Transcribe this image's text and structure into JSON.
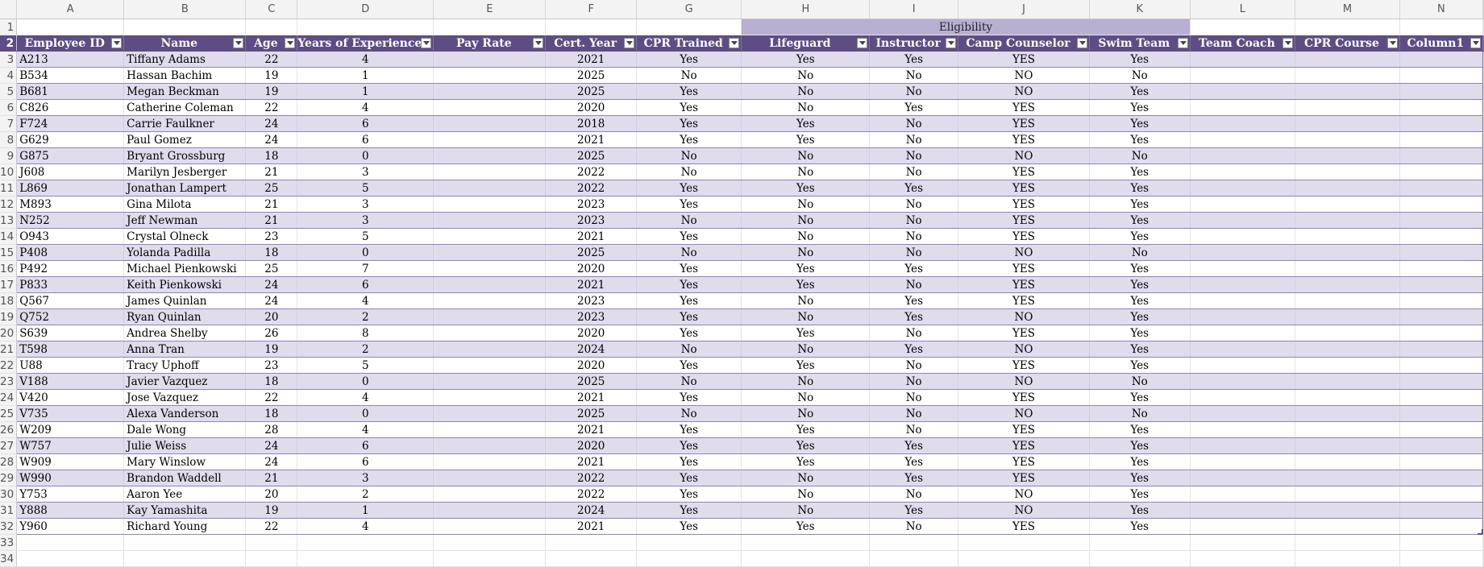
{
  "columns": [
    "A",
    "B",
    "C",
    "D",
    "E",
    "F",
    "G",
    "H",
    "I",
    "J",
    "K",
    "L",
    "M",
    "N"
  ],
  "eligibility_label": "Eligibility",
  "headers": [
    "Employee ID",
    "Name",
    "Age",
    "Years of Experience",
    "Pay Rate",
    "Cert. Year",
    "CPR Trained",
    "Lifeguard",
    "Instructor",
    "Camp Counselor",
    "Swim Team",
    "Team Coach",
    "CPR Course",
    "Column1"
  ],
  "rows": [
    [
      "A213",
      "Tiffany Adams",
      "22",
      "4",
      "",
      "2021",
      "Yes",
      "Yes",
      "Yes",
      "YES",
      "Yes"
    ],
    [
      "B534",
      "Hassan Bachim",
      "19",
      "1",
      "",
      "2025",
      "No",
      "No",
      "No",
      "NO",
      "No"
    ],
    [
      "B681",
      "Megan Beckman",
      "19",
      "1",
      "",
      "2025",
      "Yes",
      "No",
      "No",
      "NO",
      "Yes"
    ],
    [
      "C826",
      "Catherine Coleman",
      "22",
      "4",
      "",
      "2020",
      "Yes",
      "No",
      "Yes",
      "YES",
      "Yes"
    ],
    [
      "F724",
      "Carrie Faulkner",
      "24",
      "6",
      "",
      "2018",
      "Yes",
      "Yes",
      "No",
      "YES",
      "Yes"
    ],
    [
      "G629",
      "Paul Gomez",
      "24",
      "6",
      "",
      "2021",
      "Yes",
      "Yes",
      "No",
      "YES",
      "Yes"
    ],
    [
      "G875",
      "Bryant Grossburg",
      "18",
      "0",
      "",
      "2025",
      "No",
      "No",
      "No",
      "NO",
      "No"
    ],
    [
      "J608",
      "Marilyn Jesberger",
      "21",
      "3",
      "",
      "2022",
      "No",
      "No",
      "No",
      "YES",
      "Yes"
    ],
    [
      "L869",
      "Jonathan Lampert",
      "25",
      "5",
      "",
      "2022",
      "Yes",
      "Yes",
      "Yes",
      "YES",
      "Yes"
    ],
    [
      "M893",
      "Gina Milota",
      "21",
      "3",
      "",
      "2023",
      "Yes",
      "No",
      "No",
      "YES",
      "Yes"
    ],
    [
      "N252",
      "Jeff Newman",
      "21",
      "3",
      "",
      "2023",
      "No",
      "No",
      "No",
      "YES",
      "Yes"
    ],
    [
      "O943",
      "Crystal Olneck",
      "23",
      "5",
      "",
      "2021",
      "Yes",
      "No",
      "No",
      "YES",
      "Yes"
    ],
    [
      "P408",
      "Yolanda Padilla",
      "18",
      "0",
      "",
      "2025",
      "No",
      "No",
      "No",
      "NO",
      "No"
    ],
    [
      "P492",
      "Michael Pienkowski",
      "25",
      "7",
      "",
      "2020",
      "Yes",
      "Yes",
      "Yes",
      "YES",
      "Yes"
    ],
    [
      "P833",
      "Keith Pienkowski",
      "24",
      "6",
      "",
      "2021",
      "Yes",
      "Yes",
      "No",
      "YES",
      "Yes"
    ],
    [
      "Q567",
      "James Quinlan",
      "24",
      "4",
      "",
      "2023",
      "Yes",
      "No",
      "Yes",
      "YES",
      "Yes"
    ],
    [
      "Q752",
      "Ryan Quinlan",
      "20",
      "2",
      "",
      "2023",
      "Yes",
      "No",
      "Yes",
      "NO",
      "Yes"
    ],
    [
      "S639",
      "Andrea Shelby",
      "26",
      "8",
      "",
      "2020",
      "Yes",
      "Yes",
      "No",
      "YES",
      "Yes"
    ],
    [
      "T598",
      "Anna Tran",
      "19",
      "2",
      "",
      "2024",
      "No",
      "No",
      "Yes",
      "NO",
      "Yes"
    ],
    [
      "U88",
      "Tracy Uphoff",
      "23",
      "5",
      "",
      "2020",
      "Yes",
      "Yes",
      "No",
      "YES",
      "Yes"
    ],
    [
      "V188",
      "Javier Vazquez",
      "18",
      "0",
      "",
      "2025",
      "No",
      "No",
      "No",
      "NO",
      "No"
    ],
    [
      "V420",
      "Jose Vazquez",
      "22",
      "4",
      "",
      "2021",
      "Yes",
      "No",
      "No",
      "YES",
      "Yes"
    ],
    [
      "V735",
      "Alexa Vanderson",
      "18",
      "0",
      "",
      "2025",
      "No",
      "No",
      "No",
      "NO",
      "No"
    ],
    [
      "W209",
      "Dale Wong",
      "28",
      "4",
      "",
      "2021",
      "Yes",
      "Yes",
      "No",
      "YES",
      "Yes"
    ],
    [
      "W757",
      "Julie Weiss",
      "24",
      "6",
      "",
      "2020",
      "Yes",
      "Yes",
      "Yes",
      "YES",
      "Yes"
    ],
    [
      "W909",
      "Mary Winslow",
      "24",
      "6",
      "",
      "2021",
      "Yes",
      "Yes",
      "Yes",
      "YES",
      "Yes"
    ],
    [
      "W990",
      "Brandon Waddell",
      "21",
      "3",
      "",
      "2022",
      "Yes",
      "No",
      "Yes",
      "YES",
      "Yes"
    ],
    [
      "Y753",
      "Aaron Yee",
      "20",
      "2",
      "",
      "2022",
      "Yes",
      "No",
      "No",
      "NO",
      "Yes"
    ],
    [
      "Y888",
      "Kay Yamashita",
      "19",
      "1",
      "",
      "2024",
      "Yes",
      "No",
      "Yes",
      "NO",
      "Yes"
    ],
    [
      "Y960",
      "Richard Young",
      "22",
      "4",
      "",
      "2021",
      "Yes",
      "Yes",
      "No",
      "YES",
      "Yes"
    ]
  ],
  "row_numbers": [
    "1",
    "2",
    "3",
    "4",
    "5",
    "6",
    "7",
    "8",
    "9",
    "10",
    "11",
    "12",
    "13",
    "14",
    "15",
    "16",
    "17",
    "18",
    "19",
    "20",
    "21",
    "22",
    "23",
    "24",
    "25",
    "26",
    "27",
    "28",
    "29",
    "30",
    "31",
    "32",
    "33",
    "34"
  ],
  "colors": {
    "header_bg": "#5e4d84",
    "band_bg": "#e1dcec",
    "eligibility_bg": "#b9afd2"
  }
}
